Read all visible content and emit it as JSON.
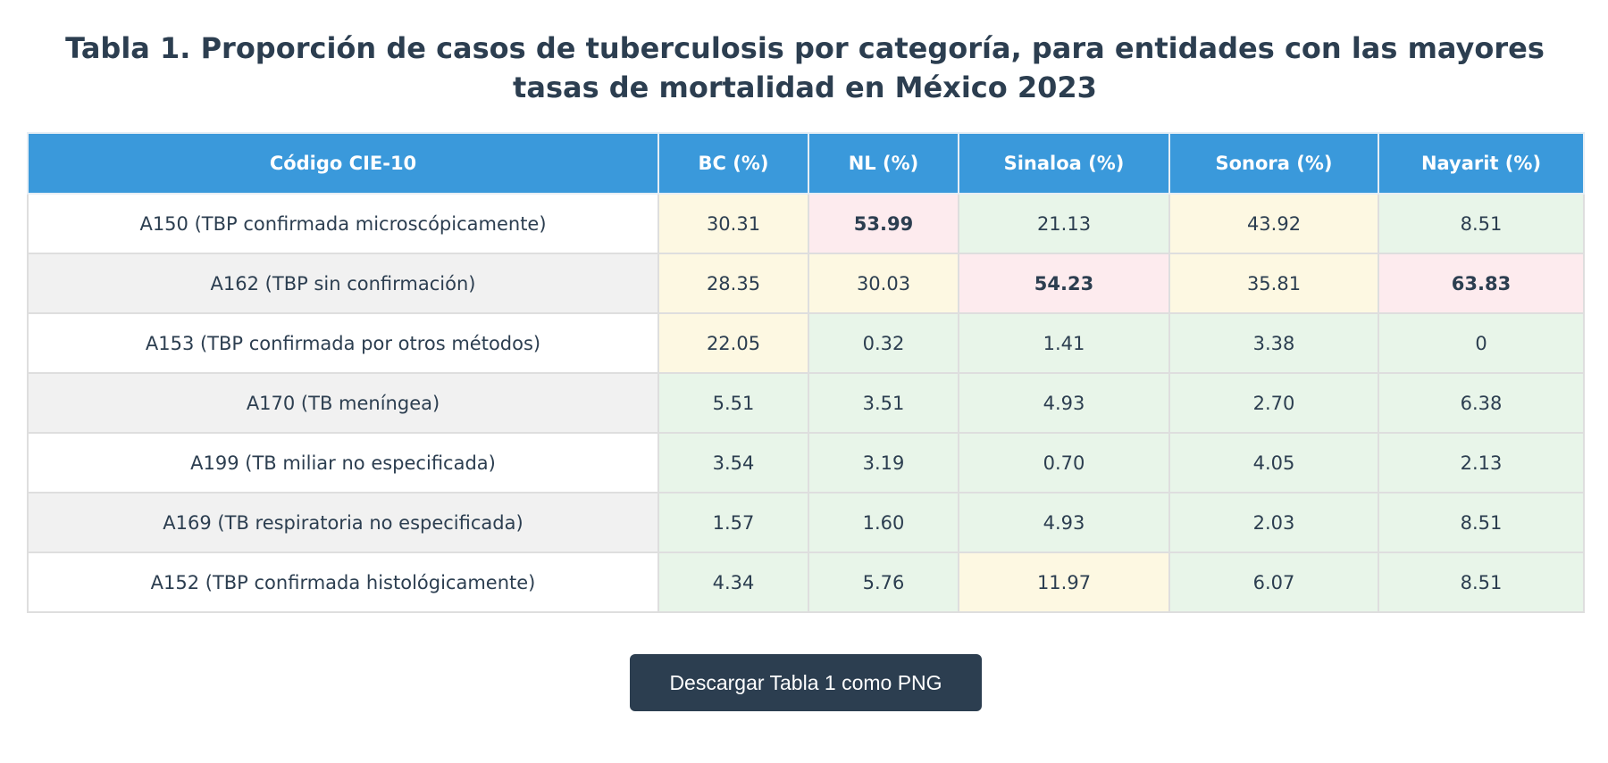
{
  "title": "Tabla 1. Proporción de casos de tuberculosis por categoría, para entidades con las mayores tasas de mortalidad en México 2023",
  "table": {
    "headers": [
      "Código CIE-10",
      "BC (%)",
      "NL (%)",
      "Sinaloa (%)",
      "Sonora (%)",
      "Nayarit (%)"
    ],
    "rows": [
      {
        "label": "A150 (TBP confirmada microscópicamente)",
        "values": [
          "30.31",
          "53.99",
          "21.13",
          "43.92",
          "8.51"
        ],
        "levels": [
          "mid",
          "high",
          "low",
          "mid",
          "low"
        ]
      },
      {
        "label": "A162 (TBP sin confirmación)",
        "values": [
          "28.35",
          "30.03",
          "54.23",
          "35.81",
          "63.83"
        ],
        "levels": [
          "mid",
          "mid",
          "high",
          "mid",
          "high"
        ]
      },
      {
        "label": "A153 (TBP confirmada por otros métodos)",
        "values": [
          "22.05",
          "0.32",
          "1.41",
          "3.38",
          "0"
        ],
        "levels": [
          "mid",
          "low",
          "low",
          "low",
          "low"
        ]
      },
      {
        "label": "A170 (TB meníngea)",
        "values": [
          "5.51",
          "3.51",
          "4.93",
          "2.70",
          "6.38"
        ],
        "levels": [
          "low",
          "low",
          "low",
          "low",
          "low"
        ]
      },
      {
        "label": "A199 (TB miliar no especificada)",
        "values": [
          "3.54",
          "3.19",
          "0.70",
          "4.05",
          "2.13"
        ],
        "levels": [
          "low",
          "low",
          "low",
          "low",
          "low"
        ]
      },
      {
        "label": "A169 (TB respiratoria no especificada)",
        "values": [
          "1.57",
          "1.60",
          "4.93",
          "2.03",
          "8.51"
        ],
        "levels": [
          "low",
          "low",
          "low",
          "low",
          "low"
        ]
      },
      {
        "label": "A152 (TBP confirmada histológicamente)",
        "values": [
          "4.34",
          "5.76",
          "11.97",
          "6.07",
          "8.51"
        ],
        "levels": [
          "low",
          "low",
          "mid",
          "low",
          "low"
        ]
      }
    ]
  },
  "download_button": {
    "label": "Descargar Tabla 1 como PNG"
  },
  "colors": {
    "header_bg": "#3a99db",
    "title_text": "#2c3e50",
    "low_bg": "#e8f5e9",
    "mid_bg": "#fdf8e2",
    "high_bg": "#fdebee",
    "button_bg": "#2c3e50"
  }
}
